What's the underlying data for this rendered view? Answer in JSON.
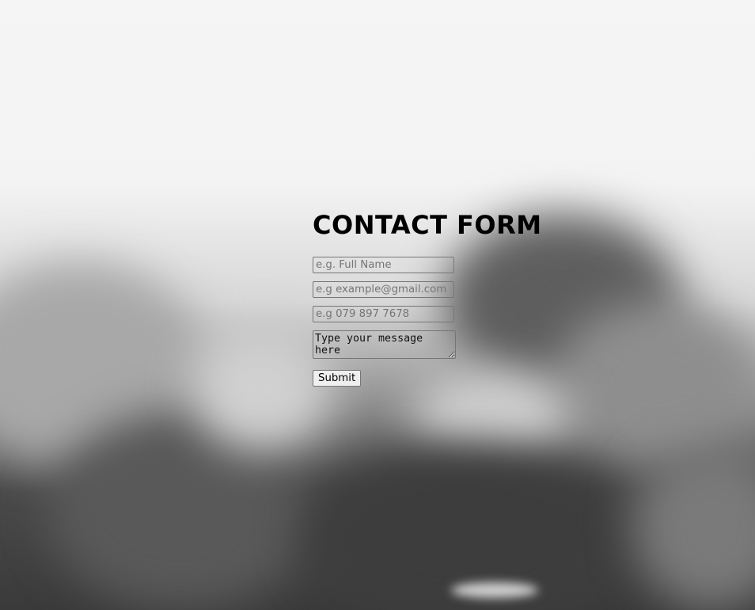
{
  "form": {
    "title": "CONTACT FORM",
    "name_placeholder": "e.g. Full Name",
    "email_placeholder": "e.g example@gmail.com",
    "phone_placeholder": "e.g 079 897 7678",
    "message_placeholder": "Type your message here",
    "submit_label": "Submit"
  }
}
